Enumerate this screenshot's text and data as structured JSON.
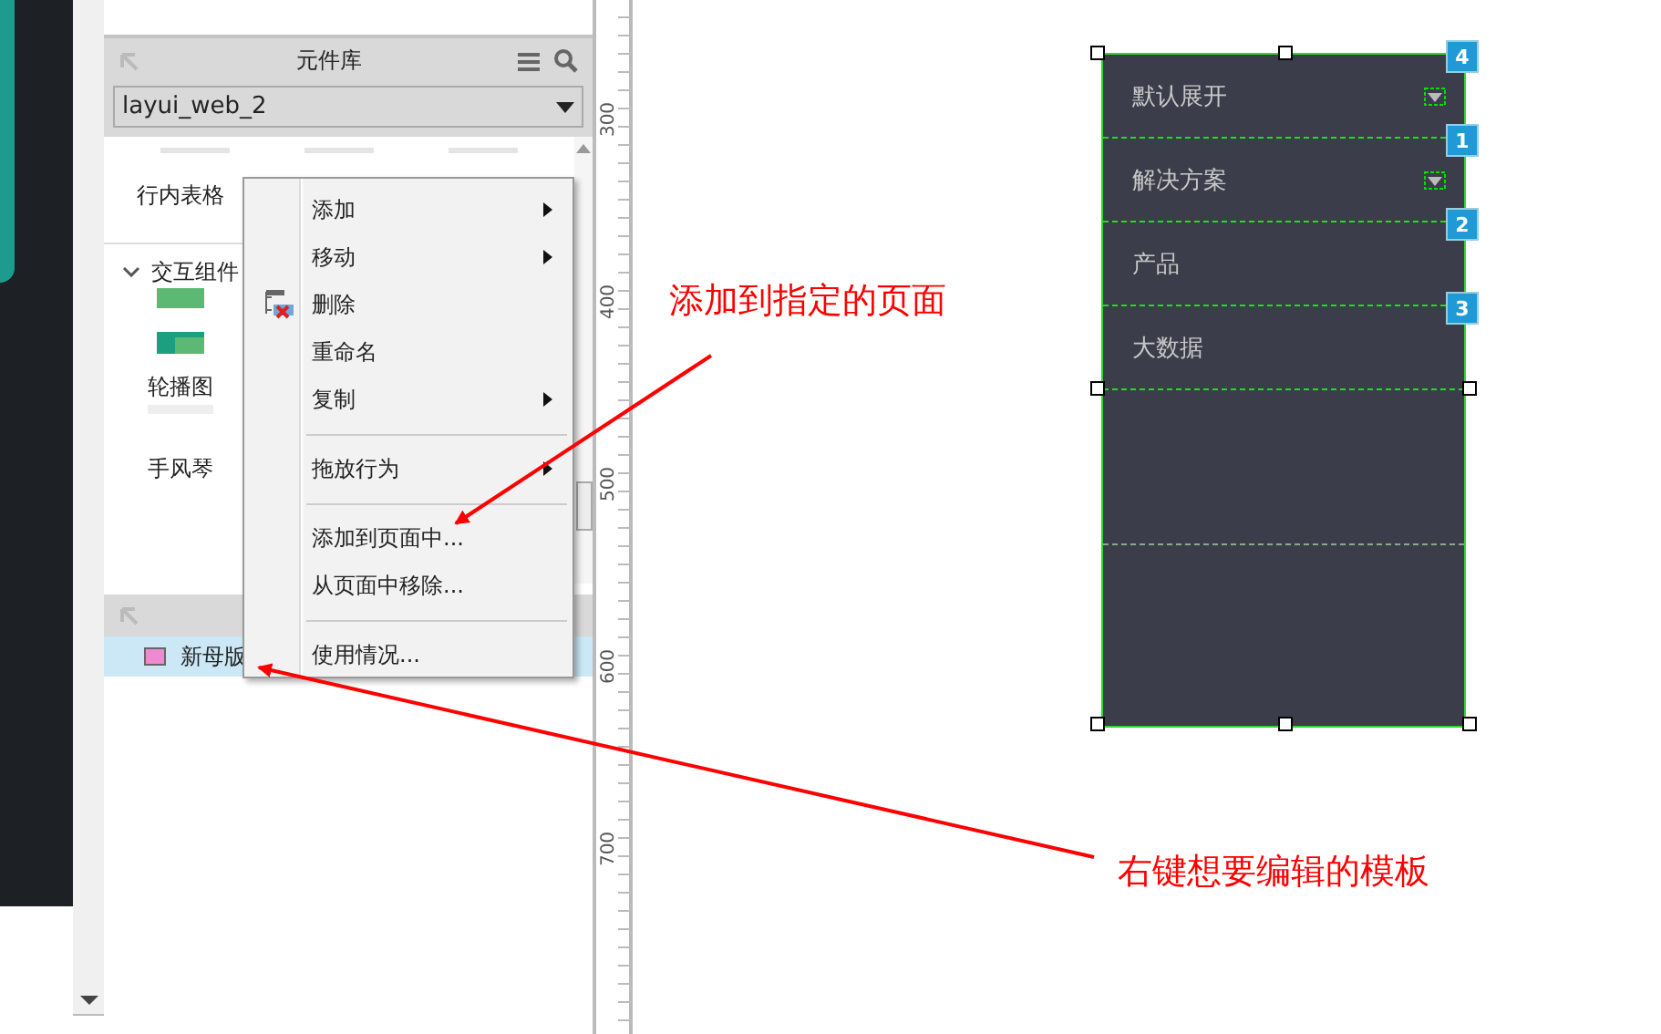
{
  "library_panel": {
    "title": "元件库",
    "library_select": {
      "value": "layui_web_2"
    },
    "items_top": [
      {
        "label": "行内表格"
      }
    ],
    "sections": [
      {
        "title": "交互组件",
        "expanded": true,
        "items": [
          {
            "label": "轮播图",
            "kind": "carousel"
          },
          {
            "label": "手风琴",
            "kind": "accordion"
          }
        ]
      }
    ]
  },
  "masters_panel": {
    "items": [
      {
        "label": "新母版",
        "selected": true
      }
    ]
  },
  "context_menu": {
    "items": [
      {
        "kind": "item",
        "label": "添加",
        "submenu": true,
        "icon": false
      },
      {
        "kind": "item",
        "label": "移动",
        "submenu": true,
        "icon": false
      },
      {
        "kind": "item",
        "label": "删除",
        "submenu": false,
        "icon": true
      },
      {
        "kind": "item",
        "label": "重命名",
        "submenu": false,
        "icon": false
      },
      {
        "kind": "item",
        "label": "复制",
        "submenu": true,
        "icon": false
      },
      {
        "kind": "separator"
      },
      {
        "kind": "item",
        "label": "拖放行为",
        "submenu": true,
        "icon": false
      },
      {
        "kind": "separator"
      },
      {
        "kind": "item",
        "label": "添加到页面中...",
        "submenu": false,
        "icon": false
      },
      {
        "kind": "item",
        "label": "从页面中移除...",
        "submenu": false,
        "icon": false
      },
      {
        "kind": "separator"
      },
      {
        "kind": "item",
        "label": "使用情况...",
        "submenu": false,
        "icon": false
      }
    ]
  },
  "ruler": {
    "labels": [
      "300",
      "400",
      "500",
      "600",
      "700"
    ]
  },
  "canvas_widget": {
    "rows": [
      {
        "label": "默认展开",
        "badge": "4",
        "expandable": true
      },
      {
        "label": "解决方案",
        "badge": "1",
        "expandable": true
      },
      {
        "label": "产品",
        "badge": "2",
        "expandable": false
      },
      {
        "label": "大数据",
        "badge": "3",
        "expandable": false
      }
    ]
  },
  "annotations": [
    {
      "text": "添加到指定的页面",
      "kind": "menu"
    },
    {
      "text": "右键想要编辑的模板",
      "kind": "master"
    }
  ]
}
